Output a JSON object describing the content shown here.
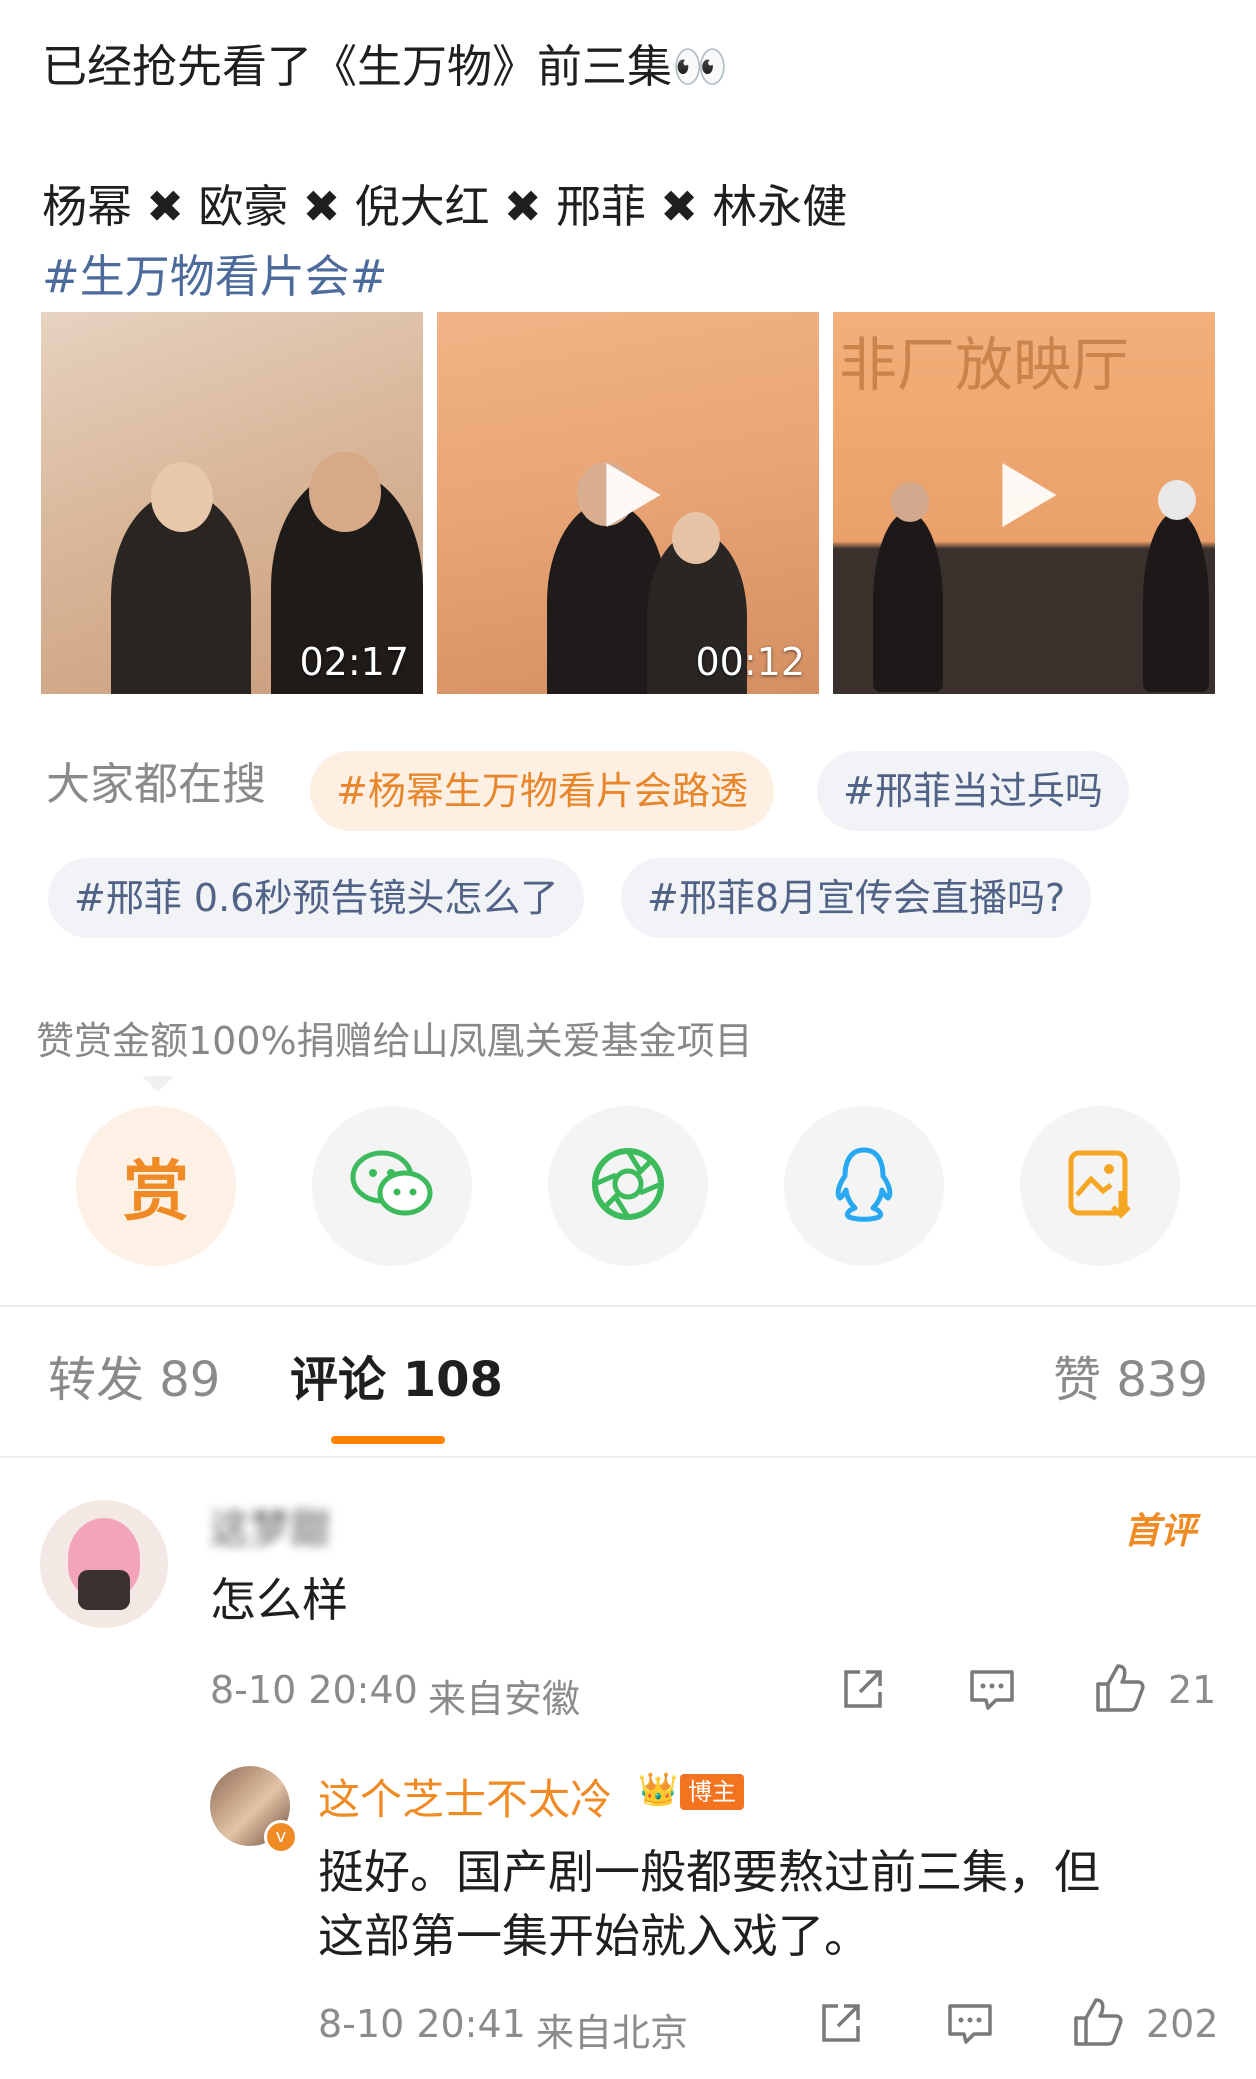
{
  "post": {
    "title_line": "已经抢先看了《生万物》前三集👀",
    "cast_line": "杨幂 ✖ 欧豪 ✖ 倪大红 ✖ 邢菲 ✖ 林永健",
    "topic": "#生万物看片会#",
    "videos": [
      {
        "duration": "02:17",
        "play": false
      },
      {
        "duration": "00:12",
        "play": true
      },
      {
        "duration": "",
        "play": true
      }
    ],
    "thumb3_banner": "非厂放映厅"
  },
  "trending": {
    "label": "大家都在搜",
    "chips": [
      {
        "text": "#杨幂生万物看片会路透",
        "hot": true
      },
      {
        "text": "#邢菲当过兵吗",
        "hot": false
      },
      {
        "text": "#邢菲 0.6秒预告镜头怎么了",
        "hot": false
      },
      {
        "text": "#邢菲8月宣传会直播吗?",
        "hot": false
      }
    ]
  },
  "donation": {
    "text": "赞赏金额100%捐赠给山凤凰关爱基金项目",
    "reward_label": "赏"
  },
  "tabs": {
    "repost": "转发 89",
    "comments": "评论 108",
    "likes": "赞 839"
  },
  "colors": {
    "accent": "#ff8200",
    "link": "#4c6a9a",
    "hot_text": "#e8862c",
    "wechat": "#3dbb5c",
    "qq": "#28a8f0",
    "save": "#f5a623"
  },
  "comment": {
    "user": "这梦甜",
    "badge": "首评",
    "text": "怎么样",
    "time": "8-10 20:40",
    "source": "来自安徽",
    "likes": "21"
  },
  "reply": {
    "user": "这个芝士不太冷",
    "badge": "博主",
    "text_line1": "挺好。国产剧一般都要熬过前三集，但",
    "text_line2": "这部第一集开始就入戏了。",
    "time": "8-10 20:41",
    "source": "来自北京",
    "likes": "202"
  }
}
